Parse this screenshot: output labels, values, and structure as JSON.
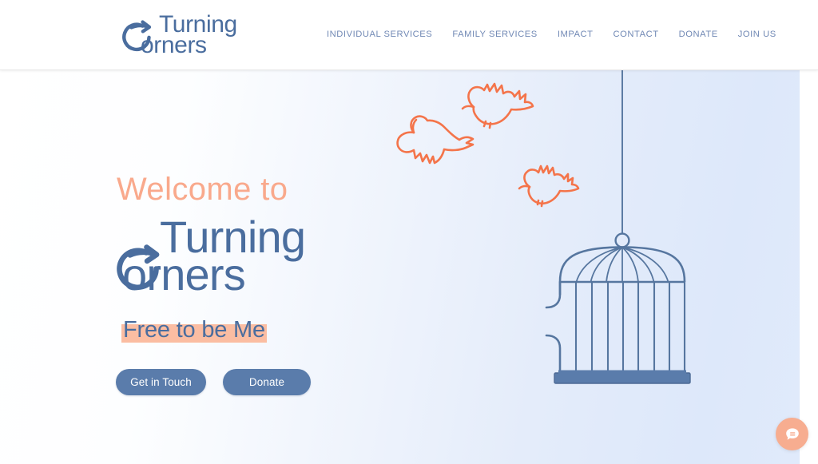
{
  "site": {
    "brand": {
      "line1": "Turning",
      "line2": "orners",
      "mark_icon": "turning-arrow-logo-icon"
    },
    "nav": [
      {
        "label": "INDIVIDUAL SERVICES"
      },
      {
        "label": "FAMILY SERVICES"
      },
      {
        "label": "IMPACT"
      },
      {
        "label": "CONTACT"
      },
      {
        "label": "DONATE"
      },
      {
        "label": "JOIN US"
      }
    ]
  },
  "hero": {
    "welcome": "Welcome to",
    "logo": {
      "line1": "Turning",
      "line2": "orners",
      "mark_icon": "turning-arrow-logo-icon"
    },
    "tagline": "Free to be Me",
    "buttons": {
      "primary": "Get in Touch",
      "secondary": "Donate"
    },
    "illustration": {
      "birdcage_icon": "birdcage-icon",
      "birds": [
        "bird-icon",
        "bird-icon",
        "bird-icon"
      ]
    }
  },
  "chat": {
    "icon": "chat-bubble-icon"
  },
  "colors": {
    "brand_blue": "#4a6d9e",
    "nav_blue": "#7189b5",
    "button_blue": "#5a7cab",
    "accent_peach": "#f9a98c",
    "highlight_peach": "#fbbda2",
    "bird_orange": "#f4744a",
    "cage_blue": "#56769f",
    "hero_bg_left": "#ffffff",
    "hero_bg_right": "#dde8fa",
    "chat_bg": "#f7ad90"
  }
}
